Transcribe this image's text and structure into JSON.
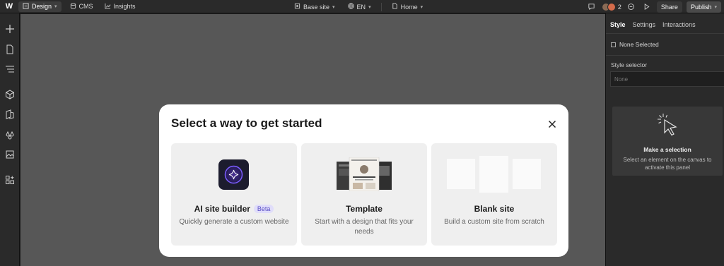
{
  "topbar": {
    "logo": "W",
    "design_label": "Design",
    "cms_label": "CMS",
    "insights_label": "Insights",
    "site_label": "Base site",
    "locale_label": "EN",
    "page_label": "Home",
    "collaborator_count": "2",
    "share_label": "Share",
    "publish_label": "Publish"
  },
  "right_panel": {
    "tabs": [
      "Style",
      "Settings",
      "Interactions"
    ],
    "none_selected": "None Selected",
    "style_selector_label": "Style selector",
    "style_selector_placeholder": "None",
    "selection_title": "Make a selection",
    "selection_desc": "Select an element on the canvas to activate this panel"
  },
  "modal": {
    "title": "Select a way to get started",
    "cards": [
      {
        "title": "AI site builder",
        "badge": "Beta",
        "desc": "Quickly generate a custom website"
      },
      {
        "title": "Template",
        "desc": "Start with a design that fits your needs"
      },
      {
        "title": "Blank site",
        "desc": "Build a custom site from scratch"
      }
    ]
  },
  "colors": {
    "canvas": "#575757",
    "panel": "#2a2a2a",
    "accent": "#5a4fc4"
  }
}
